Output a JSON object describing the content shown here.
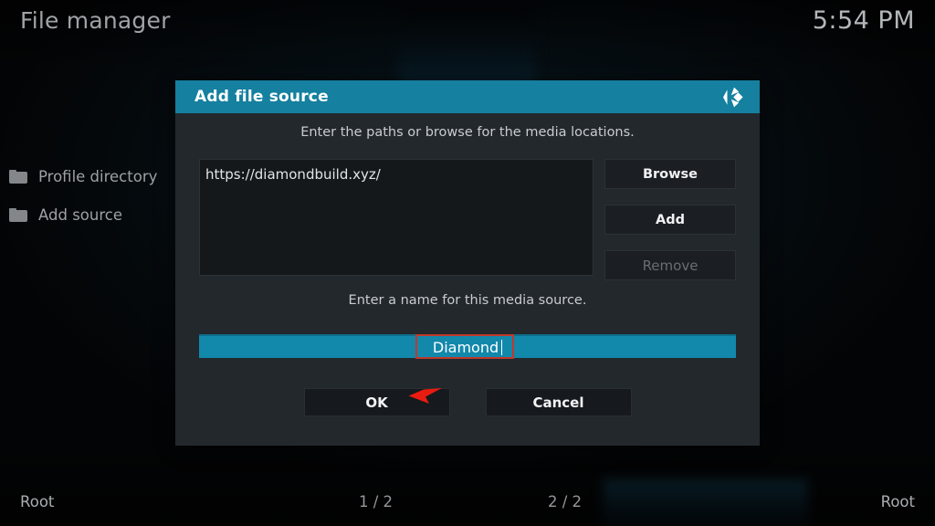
{
  "header": {
    "title": "File manager",
    "clock": "5:54 PM"
  },
  "sidebar": {
    "items": [
      {
        "label": "Profile directory",
        "icon": "folder-icon"
      },
      {
        "label": "Add source",
        "icon": "folder-icon"
      }
    ]
  },
  "dialog": {
    "title": "Add file source",
    "logo_icon": "kodi-logo-icon",
    "paths_hint": "Enter the paths or browse for the media locations.",
    "paths": [
      "https://diamondbuild.xyz/"
    ],
    "side_buttons": [
      {
        "label": "Browse",
        "enabled": true
      },
      {
        "label": "Add",
        "enabled": true
      },
      {
        "label": "Remove",
        "enabled": false
      }
    ],
    "name_hint": "Enter a name for this media source.",
    "name_value": "Diamond",
    "footer_buttons": [
      {
        "label": "OK"
      },
      {
        "label": "Cancel"
      }
    ]
  },
  "bottom_bar": {
    "left": "Root",
    "mid_left": "1 / 2",
    "mid_right": "2 / 2",
    "right": "Root"
  },
  "colors": {
    "accent_teal": "#15809f",
    "input_teal": "#1288ab",
    "dialog_body": "#23282d",
    "list_bg": "#15181b",
    "annotation_red": "#c0392b"
  }
}
